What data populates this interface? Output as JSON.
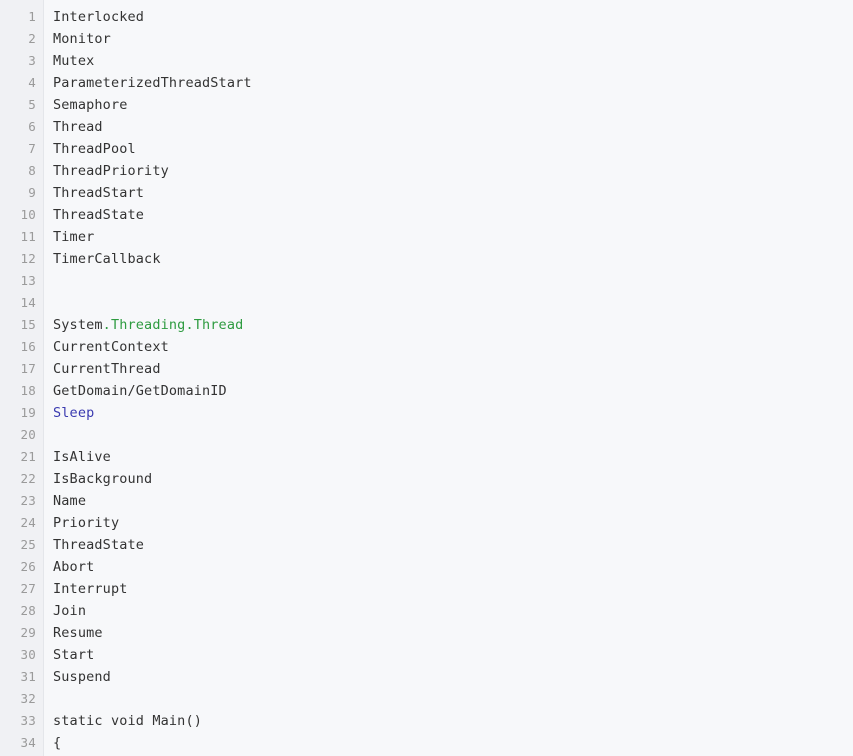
{
  "editor": {
    "name": "code-viewer",
    "background_color": "#f7f8fa",
    "gutter_color": "#f0f1f4",
    "gutter_border_color": "#e4e6ea",
    "text_color": "#333333",
    "line_number_color": "#9a9a9a",
    "line_height_px": 22,
    "first_visible_line": 1,
    "last_visible_line": 34,
    "total_visible_lines": 34
  },
  "syntax_colors": {
    "plain": "#333333",
    "namespace": "#2e9b40",
    "method": "#3a3ab0"
  },
  "lines": [
    {
      "number": "1",
      "tokens": [
        {
          "text": "Interlocked",
          "type": "plain"
        }
      ]
    },
    {
      "number": "2",
      "tokens": [
        {
          "text": "Monitor",
          "type": "plain"
        }
      ]
    },
    {
      "number": "3",
      "tokens": [
        {
          "text": "Mutex",
          "type": "plain"
        }
      ]
    },
    {
      "number": "4",
      "tokens": [
        {
          "text": "ParameterizedThreadStart",
          "type": "plain"
        }
      ]
    },
    {
      "number": "5",
      "tokens": [
        {
          "text": "Semaphore",
          "type": "plain"
        }
      ]
    },
    {
      "number": "6",
      "tokens": [
        {
          "text": "Thread",
          "type": "plain"
        }
      ]
    },
    {
      "number": "7",
      "tokens": [
        {
          "text": "ThreadPool",
          "type": "plain"
        }
      ]
    },
    {
      "number": "8",
      "tokens": [
        {
          "text": "ThreadPriority",
          "type": "plain"
        }
      ]
    },
    {
      "number": "9",
      "tokens": [
        {
          "text": "ThreadStart",
          "type": "plain"
        }
      ]
    },
    {
      "number": "10",
      "tokens": [
        {
          "text": "ThreadState",
          "type": "plain"
        }
      ]
    },
    {
      "number": "11",
      "tokens": [
        {
          "text": "Timer",
          "type": "plain"
        }
      ]
    },
    {
      "number": "12",
      "tokens": [
        {
          "text": "TimerCallback",
          "type": "plain"
        }
      ]
    },
    {
      "number": "13",
      "tokens": []
    },
    {
      "number": "14",
      "tokens": []
    },
    {
      "number": "15",
      "tokens": [
        {
          "text": "System",
          "type": "plain"
        },
        {
          "text": ".Threading.Thread",
          "type": "namespace"
        }
      ]
    },
    {
      "number": "16",
      "tokens": [
        {
          "text": "CurrentContext",
          "type": "plain"
        }
      ]
    },
    {
      "number": "17",
      "tokens": [
        {
          "text": "CurrentThread",
          "type": "plain"
        }
      ]
    },
    {
      "number": "18",
      "tokens": [
        {
          "text": "GetDomain/GetDomainID",
          "type": "plain"
        }
      ]
    },
    {
      "number": "19",
      "tokens": [
        {
          "text": "Sleep",
          "type": "method"
        }
      ]
    },
    {
      "number": "20",
      "tokens": []
    },
    {
      "number": "21",
      "tokens": [
        {
          "text": "IsAlive",
          "type": "plain"
        }
      ]
    },
    {
      "number": "22",
      "tokens": [
        {
          "text": "IsBackground",
          "type": "plain"
        }
      ]
    },
    {
      "number": "23",
      "tokens": [
        {
          "text": "Name",
          "type": "plain"
        }
      ]
    },
    {
      "number": "24",
      "tokens": [
        {
          "text": "Priority",
          "type": "plain"
        }
      ]
    },
    {
      "number": "25",
      "tokens": [
        {
          "text": "ThreadState",
          "type": "plain"
        }
      ]
    },
    {
      "number": "26",
      "tokens": [
        {
          "text": "Abort",
          "type": "plain"
        }
      ]
    },
    {
      "number": "27",
      "tokens": [
        {
          "text": "Interrupt",
          "type": "plain"
        }
      ]
    },
    {
      "number": "28",
      "tokens": [
        {
          "text": "Join",
          "type": "plain"
        }
      ]
    },
    {
      "number": "29",
      "tokens": [
        {
          "text": "Resume",
          "type": "plain"
        }
      ]
    },
    {
      "number": "30",
      "tokens": [
        {
          "text": "Start",
          "type": "plain"
        }
      ]
    },
    {
      "number": "31",
      "tokens": [
        {
          "text": "Suspend",
          "type": "plain"
        }
      ]
    },
    {
      "number": "32",
      "tokens": []
    },
    {
      "number": "33",
      "tokens": [
        {
          "text": "static void Main()",
          "type": "plain"
        }
      ]
    },
    {
      "number": "34",
      "tokens": [
        {
          "text": "{",
          "type": "plain"
        }
      ]
    }
  ]
}
